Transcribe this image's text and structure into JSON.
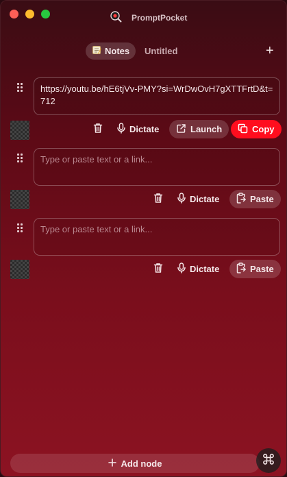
{
  "window": {
    "title": "PromptPocket"
  },
  "tabs": [
    {
      "icon": "memo-icon",
      "label": "Notes",
      "active": true
    },
    {
      "label": "Untitled",
      "active": false
    }
  ],
  "add_tab_label": "+",
  "nodes": [
    {
      "text": "https://youtu.be/hE6tjVv-PMY?si=WrDwOvH7gXTTFrtD&t=712",
      "placeholder": "",
      "dictate_label": "Dictate",
      "launch_label": "Launch",
      "copy_label": "Copy"
    },
    {
      "text": "",
      "placeholder": "Type or paste text or a link...",
      "dictate_label": "Dictate",
      "paste_label": "Paste"
    },
    {
      "text": "",
      "placeholder": "Type or paste text or a link...",
      "dictate_label": "Dictate",
      "paste_label": "Paste"
    }
  ],
  "footer": {
    "add_node_label": "Add node"
  },
  "colors": {
    "accent": "#ff0d1e",
    "background_top": "#3a0c14",
    "background_bottom": "#8c1322"
  }
}
